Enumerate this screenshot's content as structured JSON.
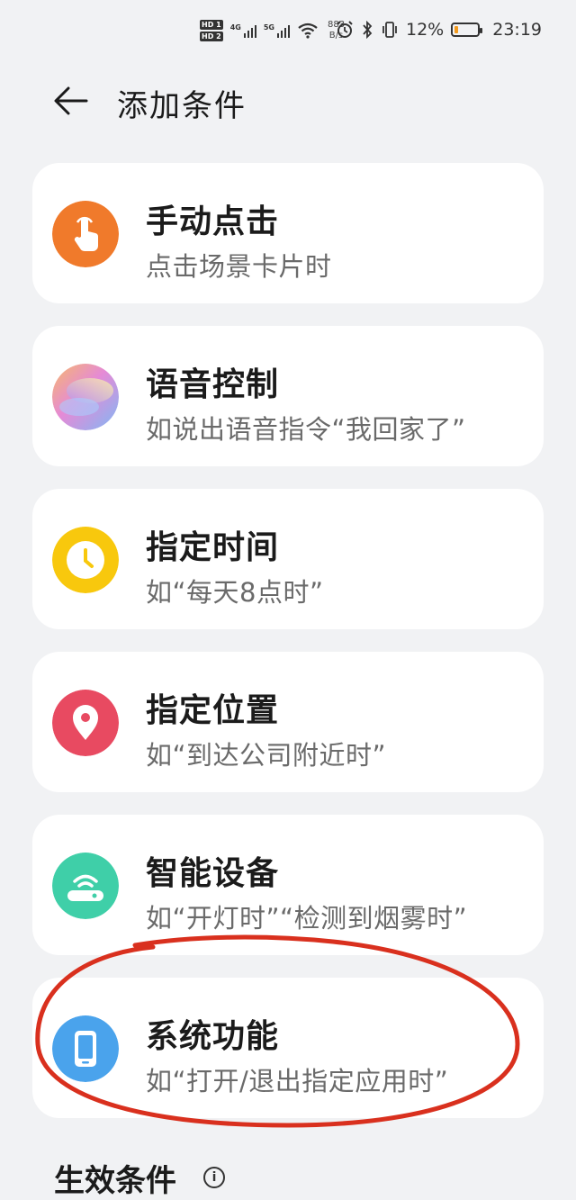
{
  "status_bar": {
    "hd1": "HD 1",
    "hd2": "HD 2",
    "sim1": "4G",
    "sim2": "5G",
    "net_speed_value": "883",
    "net_speed_unit": "B/s",
    "battery_percent": "12%",
    "battery_level": 0.12,
    "time": "23:19",
    "icons": [
      "alarm-icon",
      "bluetooth-icon",
      "vibrate-icon",
      "battery-icon"
    ]
  },
  "header": {
    "back_icon": "arrow-left-icon",
    "title": "添加条件"
  },
  "conditions": [
    {
      "title": "手动点击",
      "subtitle": "点击场景卡片时",
      "icon": "tap-hand-icon",
      "color": "#f07a2b"
    },
    {
      "title": "语音控制",
      "subtitle": "如说出语音指令“我回家了”",
      "icon": "voice-assistant-icon",
      "color": "#c78fe8"
    },
    {
      "title": "指定时间",
      "subtitle": "如“每天8点时”",
      "icon": "clock-icon",
      "color": "#f8c80d"
    },
    {
      "title": "指定位置",
      "subtitle": "如“到达公司附近时”",
      "icon": "location-pin-icon",
      "color": "#e84a61"
    },
    {
      "title": "智能设备",
      "subtitle": "如“开灯时”“检测到烟雾时”",
      "icon": "smart-device-icon",
      "color": "#3fcfa8"
    },
    {
      "title": "系统功能",
      "subtitle": "如“打开/退出指定应用时”",
      "icon": "phone-icon",
      "color": "#4aa3ec"
    }
  ],
  "section": {
    "title": "生效条件",
    "info_icon": "info-icon"
  },
  "annotation": {
    "color": "#d9301e"
  }
}
